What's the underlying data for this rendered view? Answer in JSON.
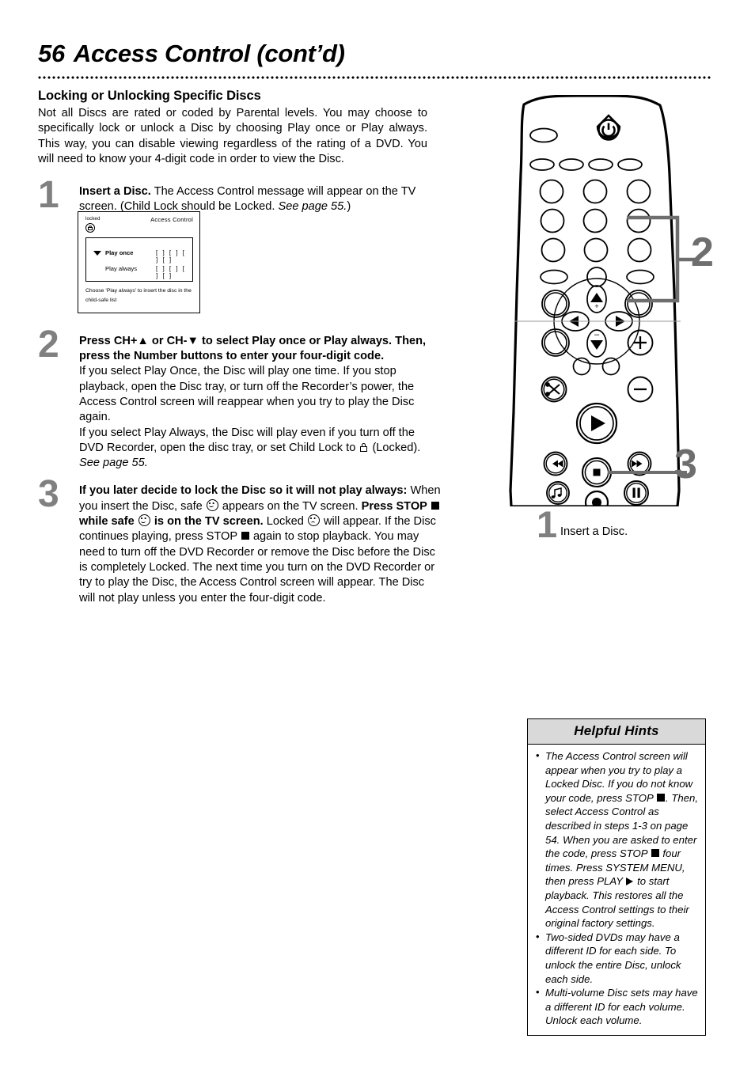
{
  "header": {
    "page_number": "56",
    "title": "Access Control (cont’d)"
  },
  "left": {
    "section_heading": "Locking or Unlocking Specific Discs",
    "intro": "Not all Discs are rated or coded by Parental levels. You may choose to specifically lock or unlock a Disc by choosing Play once or Play always. This way, you can disable viewing regardless of the rating of a DVD. You will need to know your 4-digit code in order to view the Disc.",
    "steps": [
      {
        "number": "1",
        "lead": "Insert a Disc.",
        "body_a": " The Access Control message will appear on the TV screen. (Child Lock should be Locked. ",
        "italic": "See page 55.",
        "body_b": ")"
      },
      {
        "number": "2",
        "lead": "Press CH+▲ or CH-▼ to select Play once or Play always. Then, press the Number buttons to enter your four-digit code.",
        "para1": "If you select Play Once, the Disc will play one time. If you stop playback, open the Disc tray, or turn off the Recorder’s power, the Access Control screen will reappear when you try to play the Disc again.",
        "para2_a": "If you select Play Always, the Disc will play even if you turn off the DVD Recorder, open the disc tray, or set Child Lock to ",
        "para2_b": " (Locked). ",
        "para2_italic": "See page 55."
      },
      {
        "number": "3",
        "lead": "If you later decide to lock the Disc so it will not play always:",
        "t1": " When you insert the Disc, safe ",
        "t2": " appears on the TV screen. ",
        "bold1": "Press STOP ",
        "bold2": " while safe ",
        "bold3": " is on the TV screen.",
        "t3": " Locked ",
        "t4": " will appear. If the Disc continues playing, press STOP ",
        "t5": " again to stop playback. You may need to turn off the DVD Recorder or remove the Disc before the Disc is completely Locked. The next time you turn on the DVD Recorder or try to play the Disc, the Access Control screen will appear. The Disc will not play unless you enter the four-digit code."
      }
    ]
  },
  "tv_screen": {
    "locked_label": "locked",
    "title": "Access Control",
    "options": [
      {
        "label": "Play once",
        "code": "[ ] [ ] [ ] [ ]",
        "selected": true
      },
      {
        "label": "Play always",
        "code": "[ ] [ ] [ ] [ ]",
        "selected": false
      }
    ],
    "footer": "Choose ‘Play always’ to insert the disc in the child-safe list"
  },
  "remote": {
    "callouts": [
      {
        "id": "2",
        "label": "2"
      },
      {
        "id": "3",
        "label": "3"
      }
    ],
    "caption_1": {
      "number": "1",
      "text": "Insert a Disc."
    }
  },
  "hints": {
    "title": "Helpful Hints",
    "items": [
      {
        "a": "The Access Control screen will appear when you try to play a Locked Disc. If you do not know your code, press STOP ",
        "b": ". Then, select Access Control as described in steps 1-3 on page 54. When you are asked to enter the code, press STOP ",
        "c": " four times. Press SYSTEM MENU, then press PLAY ",
        "d": " to start playback. This restores all the Access Control settings to their original factory settings."
      },
      {
        "a": "Two-sided DVDs may have a different ID for each side. To unlock the entire Disc, unlock each side."
      },
      {
        "a": "Multi-volume Disc sets may have a different ID for each volume. Unlock each volume."
      }
    ]
  },
  "colors": {
    "step_number": "#808080",
    "callout": "#6e6e6e",
    "hints_header_bg": "#d9d9d9"
  }
}
